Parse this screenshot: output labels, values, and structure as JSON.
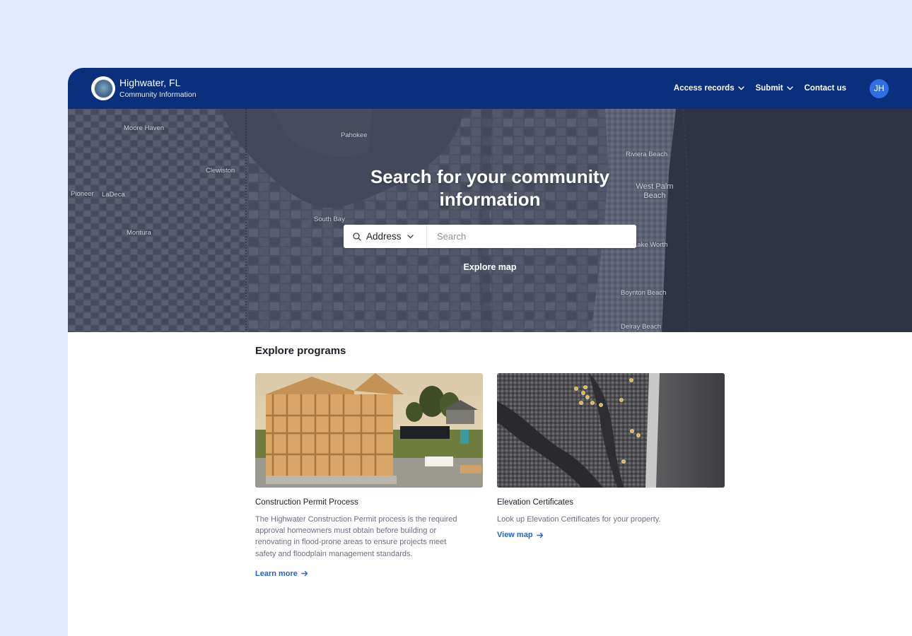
{
  "header": {
    "title": "Highwater, FL",
    "subtitle": "Community Information",
    "nav": [
      {
        "label": "Access records"
      },
      {
        "label": "Submit"
      },
      {
        "label": "Contact us"
      }
    ],
    "avatar_initials": "JH"
  },
  "hero": {
    "title": "Search for your community information",
    "search_type": "Address",
    "search_placeholder": "Search",
    "explore_map_label": "Explore map",
    "map_labels": [
      "Moore Haven",
      "Pahokee",
      "Riviera Beach",
      "Clewiston",
      "West Palm Beach",
      "Pioneer",
      "LaDeca",
      "South Bay",
      "Montura",
      "Lake Worth",
      "Boynton Beach",
      "Delray Beach"
    ]
  },
  "programs": {
    "title": "Explore programs",
    "cards": [
      {
        "title": "Construction Permit Process",
        "description": "The Highwater Construction Permit process is the required approval homeowners must obtain before building or renovating in flood-prone areas to ensure projects meet safety and floodplain management standards.",
        "link_label": "Learn more"
      },
      {
        "title": "Elevation Certificates",
        "description": "Look up Elevation Certificates for your property.",
        "link_label": "View map"
      }
    ]
  },
  "colors": {
    "header_bg": "#0a2f7c",
    "accent": "#2362d6",
    "avatar_bg": "#2f6fe5",
    "page_bg": "#e3ebfd"
  }
}
